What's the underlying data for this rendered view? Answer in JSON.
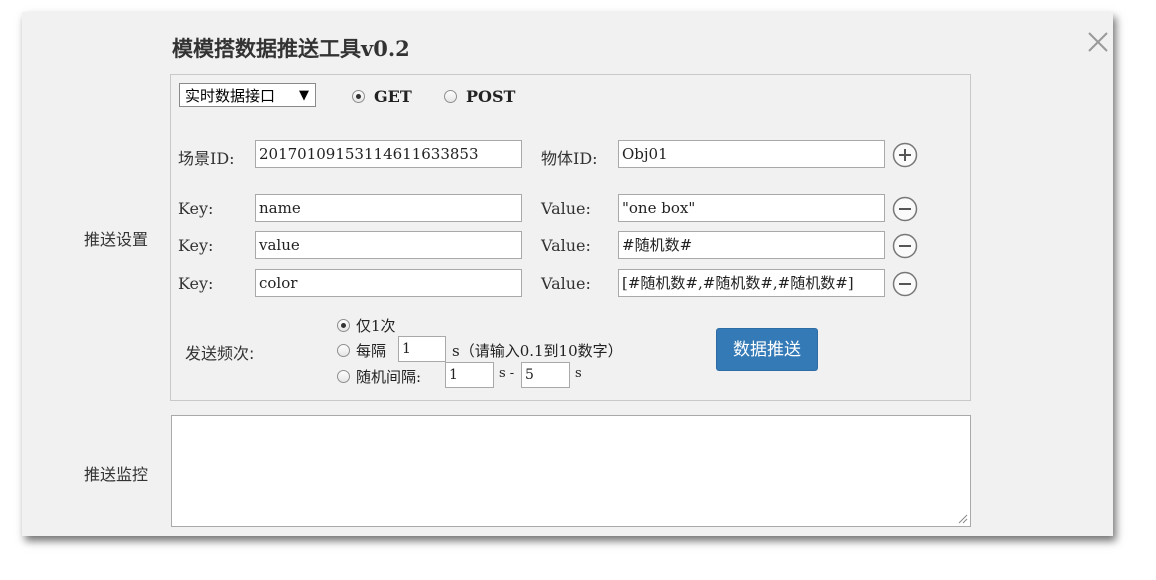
{
  "title": "模模搭数据推送工具v0.2",
  "icons": {
    "close": "close-icon",
    "add": "plus-circle-icon",
    "remove": "minus-circle-icon",
    "dropdown": "triangle-down-icon"
  },
  "colors": {
    "primary_button": "#337ab7",
    "dialog_bg": "#f1f1f1"
  },
  "sections": {
    "settings_label": "推送设置",
    "monitor_label": "推送监控"
  },
  "interface_select": {
    "selected": "实时数据接口",
    "arrow": "▼"
  },
  "method": {
    "options": [
      {
        "label": "GET",
        "checked": true
      },
      {
        "label": "POST",
        "checked": false
      }
    ]
  },
  "scene": {
    "label": "场景ID:",
    "value": "20170109153114611633853"
  },
  "object": {
    "label": "物体ID:",
    "value": "Obj01"
  },
  "pairs": [
    {
      "key_label": "Key:",
      "key": "name",
      "value_label": "Value:",
      "value": "\"one box\""
    },
    {
      "key_label": "Key:",
      "key": "value",
      "value_label": "Value:",
      "value": "#随机数#"
    },
    {
      "key_label": "Key:",
      "key": "color",
      "value_label": "Value:",
      "value": "[#随机数#,#随机数#,#随机数#]"
    }
  ],
  "frequency": {
    "label": "发送频次:",
    "once": {
      "label": "仅1次",
      "checked": true
    },
    "interval": {
      "label": "每隔",
      "value": "1",
      "unit": "s（请输入0.1到10数字）",
      "checked": false
    },
    "random": {
      "label": "随机间隔:",
      "min": "1",
      "sep": "s -",
      "max": "5",
      "unit": "s",
      "checked": false
    }
  },
  "push_button": "数据推送",
  "monitor_text": ""
}
